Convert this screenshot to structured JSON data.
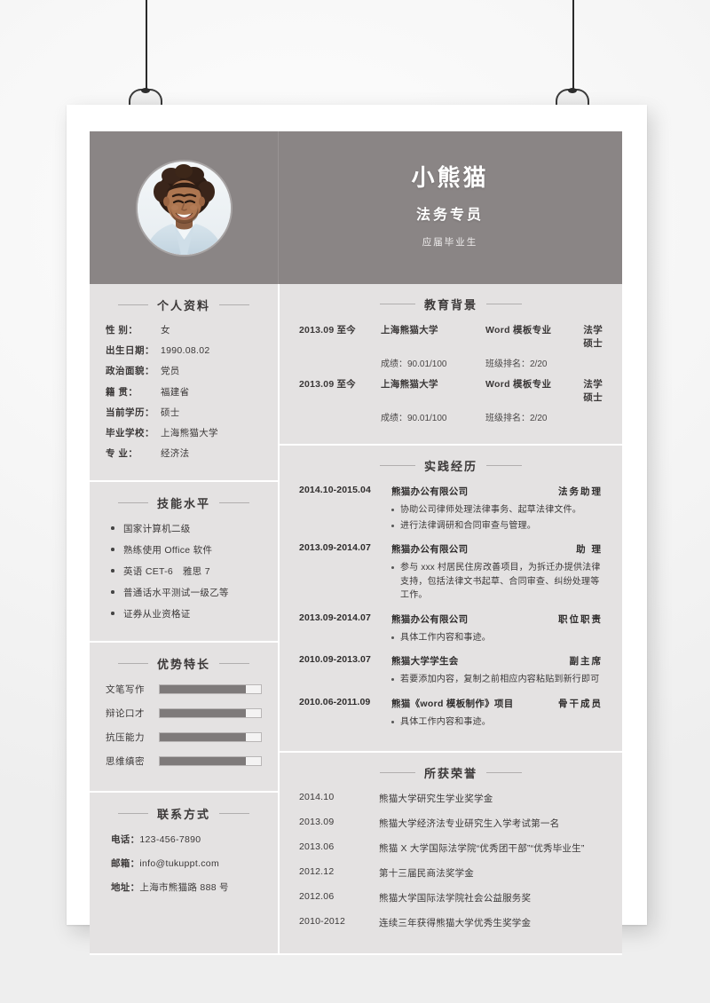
{
  "header": {
    "name": "小熊猫",
    "role": "法务专员",
    "status": "应届毕业生",
    "accent_color": "#8a8585",
    "panel_color": "#e4e2e2"
  },
  "personal": {
    "title": "个人资料",
    "rows": [
      {
        "label": "性    别：",
        "value": "女"
      },
      {
        "label": "出生日期：",
        "value": "1990.08.02"
      },
      {
        "label": "政治面貌：",
        "value": "党员"
      },
      {
        "label": "籍    贯：",
        "value": "福建省"
      },
      {
        "label": "当前学历：",
        "value": "硕士"
      },
      {
        "label": "毕业学校：",
        "value": "上海熊猫大学"
      },
      {
        "label": "专    业：",
        "value": "经济法"
      }
    ]
  },
  "skills": {
    "title": "技能水平",
    "items": [
      "国家计算机二级",
      "熟练使用 Office 软件",
      "英语 CET-6　雅思 7",
      "普通话水平测试一级乙等",
      "证券从业资格证"
    ]
  },
  "strengths": {
    "title": "优势特长",
    "items": [
      {
        "label": "文笔写作",
        "percent": 85
      },
      {
        "label": "辩论口才",
        "percent": 85
      },
      {
        "label": "抗压能力",
        "percent": 85
      },
      {
        "label": "思维缜密",
        "percent": 85
      }
    ]
  },
  "contact": {
    "title": "联系方式",
    "rows": [
      {
        "label": "电话：",
        "value": "123-456-7890"
      },
      {
        "label": "邮箱：",
        "value": "info@tukuppt.com"
      },
      {
        "label": "地址：",
        "value": "上海市熊猫路 888 号"
      }
    ]
  },
  "education": {
    "title": "教育背景",
    "entries": [
      {
        "date": "2013.09  至今",
        "school": "上海熊猫大学",
        "major": "Word 模板专业",
        "degree": "法学硕士",
        "score": "成绩：90.01/100",
        "rank": "班级排名：2/20"
      },
      {
        "date": "2013.09  至今",
        "school": "上海熊猫大学",
        "major": "Word 模板专业",
        "degree": "法学硕士",
        "score": "成绩：90.01/100",
        "rank": "班级排名：2/20"
      }
    ]
  },
  "experience": {
    "title": "实践经历",
    "entries": [
      {
        "date": "2014.10-2015.04",
        "org": "熊猫办公有限公司",
        "role": "法务助理",
        "points": [
          "协助公司律师处理法律事务、起草法律文件。",
          "进行法律调研和合同审查与管理。"
        ]
      },
      {
        "date": "2013.09-2014.07",
        "org": "熊猫办公有限公司",
        "role": "助 理",
        "points": [
          "参与 xxx 村居民住房改善项目，为拆迁办提供法律支持，包括法律文书起草、合同审查、纠纷处理等工作。"
        ]
      },
      {
        "date": "2013.09-2014.07",
        "org": "熊猫办公有限公司",
        "role": "职位职责",
        "points": [
          "具体工作内容和事迹。"
        ]
      },
      {
        "date": "2010.09-2013.07",
        "org": "熊猫大学学生会",
        "role": "副主席",
        "points": [
          "若要添加内容，复制之前相应内容粘贴到新行即可"
        ]
      },
      {
        "date": "2010.06-2011.09",
        "org": "熊猫《word 模板制作》项目",
        "role": "骨干成员",
        "points": [
          "具体工作内容和事迹。"
        ]
      }
    ]
  },
  "honors": {
    "title": "所获荣誉",
    "rows": [
      {
        "date": "2014.10",
        "text": "熊猫大学研究生学业奖学金"
      },
      {
        "date": "2013.09",
        "text": "熊猫大学经济法专业研究生入学考试第一名"
      },
      {
        "date": "2013.06",
        "text": "熊猫 X 大学国际法学院“优秀团干部”“优秀毕业生”"
      },
      {
        "date": "2012.12",
        "text": "第十三届民商法奖学金"
      },
      {
        "date": "2012.06",
        "text": "熊猫大学国际法学院社会公益服务奖"
      },
      {
        "date": "2010-2012",
        "text": "连续三年获得熊猫大学优秀生奖学金"
      }
    ]
  }
}
